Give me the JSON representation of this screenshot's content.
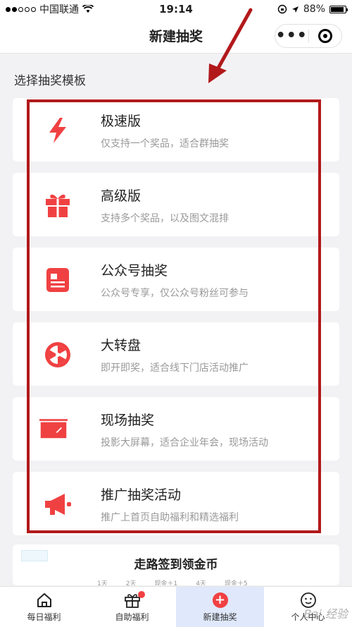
{
  "status_bar": {
    "carrier": "中国联通",
    "time": "19:14",
    "battery": "88%"
  },
  "header": {
    "title": "新建抽奖"
  },
  "section_label": "选择抽奖模板",
  "templates": [
    {
      "title": "极速版",
      "subtitle": "仅支持一个奖品，适合群抽奖",
      "icon": "lightning-icon"
    },
    {
      "title": "高级版",
      "subtitle": "支持多个奖品，以及图文混排",
      "icon": "gift-icon"
    },
    {
      "title": "公众号抽奖",
      "subtitle": "公众号专享，仅公众号粉丝可参与",
      "icon": "document-icon"
    },
    {
      "title": "大转盘",
      "subtitle": "即开即奖，适合线下门店活动推广",
      "icon": "wheel-icon"
    },
    {
      "title": "现场抽奖",
      "subtitle": "投影大屏幕，适合企业年会，现场活动",
      "icon": "screen-icon"
    },
    {
      "title": "推广抽奖活动",
      "subtitle": "推广上首页自助福利和精选福利",
      "icon": "megaphone-icon"
    }
  ],
  "banner": {
    "title": "走路签到领金币",
    "steps": [
      "1天",
      "2天",
      "现金＋1",
      "4天",
      "现金＋5"
    ]
  },
  "tabs": [
    {
      "label": "每日福利",
      "icon": "home-icon"
    },
    {
      "label": "自助福利",
      "icon": "gift-icon"
    },
    {
      "label": "新建抽奖",
      "icon": "plus-icon"
    },
    {
      "label": "个人中心",
      "icon": "smiley-icon"
    }
  ],
  "watermark": "Bai 经验",
  "colors": {
    "accent": "#f04142",
    "highlight": "#b2191b"
  }
}
